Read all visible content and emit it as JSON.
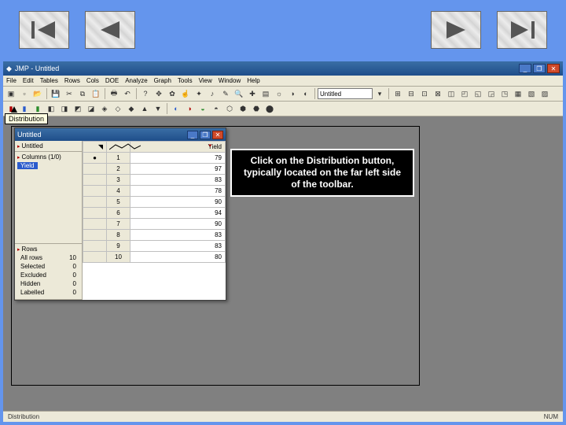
{
  "nav": {
    "first_icon": "first-icon",
    "prev_icon": "prev-icon",
    "next_icon": "next-icon",
    "last_icon": "last-icon"
  },
  "app": {
    "icon_label": "JMP",
    "title": "JMP - Untitled",
    "window_minimize": "_",
    "window_maximize": "❐",
    "window_close": "✕",
    "menus": [
      "File",
      "Edit",
      "Tables",
      "Rows",
      "Cols",
      "DOE",
      "Analyze",
      "Graph",
      "Tools",
      "View",
      "Window",
      "Help"
    ],
    "toolbar_field": "Untitled",
    "tooltip": "Distribution",
    "status_left": "Distribution",
    "status_right": "NUM"
  },
  "callout": {
    "text": "Click on the Distribution button, typically located on the far left side of the toolbar."
  },
  "datawin": {
    "title": "Untitled",
    "panel_source": "Untitled",
    "columns_header": "Columns (1/0)",
    "column_name": "Yield",
    "grid_header": "Yield",
    "rows_header": "Rows",
    "rows": [
      {
        "label": "All rows",
        "value": "10"
      },
      {
        "label": "Selected",
        "value": "0"
      },
      {
        "label": "Excluded",
        "value": "0"
      },
      {
        "label": "Hidden",
        "value": "0"
      },
      {
        "label": "Labelled",
        "value": "0"
      }
    ],
    "data": [
      {
        "row": "1",
        "val": "79"
      },
      {
        "row": "2",
        "val": "97"
      },
      {
        "row": "3",
        "val": "83"
      },
      {
        "row": "4",
        "val": "78"
      },
      {
        "row": "5",
        "val": "90"
      },
      {
        "row": "6",
        "val": "94"
      },
      {
        "row": "7",
        "val": "90"
      },
      {
        "row": "8",
        "val": "83"
      },
      {
        "row": "9",
        "val": "83"
      },
      {
        "row": "10",
        "val": "80"
      }
    ]
  }
}
